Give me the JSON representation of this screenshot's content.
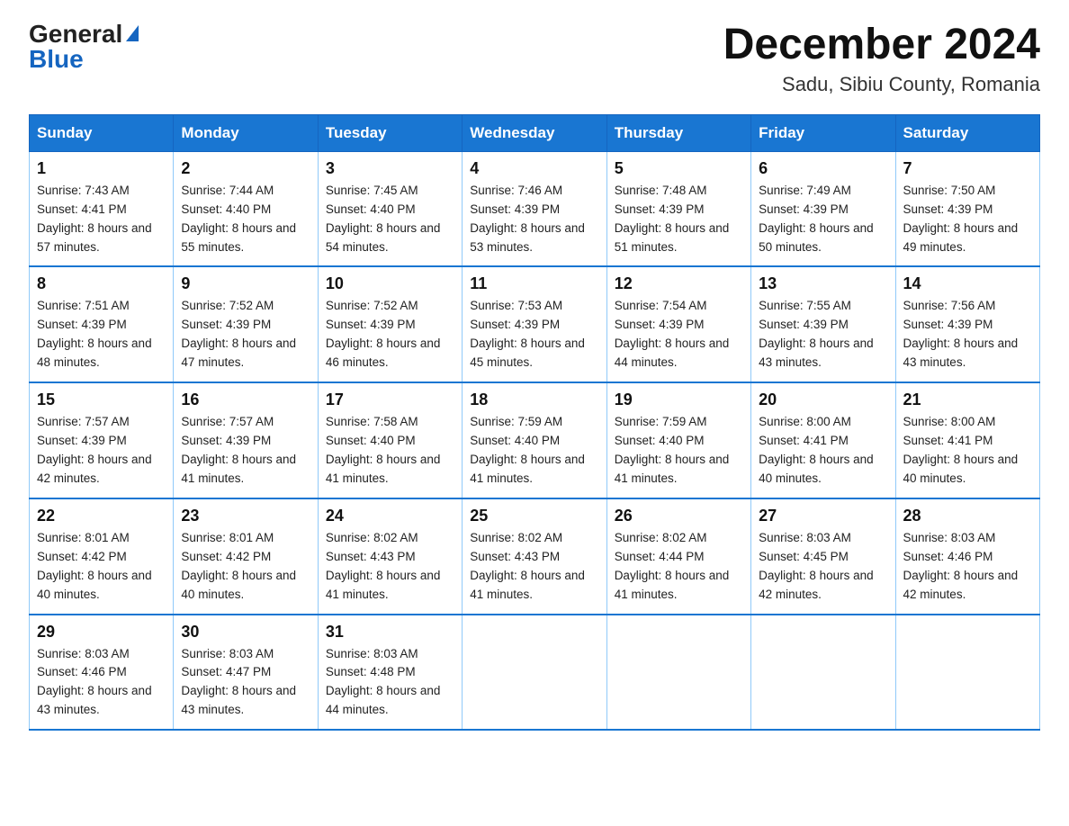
{
  "logo": {
    "general": "General",
    "blue": "Blue"
  },
  "title": "December 2024",
  "location": "Sadu, Sibiu County, Romania",
  "headers": [
    "Sunday",
    "Monday",
    "Tuesday",
    "Wednesday",
    "Thursday",
    "Friday",
    "Saturday"
  ],
  "weeks": [
    [
      {
        "day": "1",
        "sunrise": "7:43 AM",
        "sunset": "4:41 PM",
        "daylight": "8 hours and 57 minutes."
      },
      {
        "day": "2",
        "sunrise": "7:44 AM",
        "sunset": "4:40 PM",
        "daylight": "8 hours and 55 minutes."
      },
      {
        "day": "3",
        "sunrise": "7:45 AM",
        "sunset": "4:40 PM",
        "daylight": "8 hours and 54 minutes."
      },
      {
        "day": "4",
        "sunrise": "7:46 AM",
        "sunset": "4:39 PM",
        "daylight": "8 hours and 53 minutes."
      },
      {
        "day": "5",
        "sunrise": "7:48 AM",
        "sunset": "4:39 PM",
        "daylight": "8 hours and 51 minutes."
      },
      {
        "day": "6",
        "sunrise": "7:49 AM",
        "sunset": "4:39 PM",
        "daylight": "8 hours and 50 minutes."
      },
      {
        "day": "7",
        "sunrise": "7:50 AM",
        "sunset": "4:39 PM",
        "daylight": "8 hours and 49 minutes."
      }
    ],
    [
      {
        "day": "8",
        "sunrise": "7:51 AM",
        "sunset": "4:39 PM",
        "daylight": "8 hours and 48 minutes."
      },
      {
        "day": "9",
        "sunrise": "7:52 AM",
        "sunset": "4:39 PM",
        "daylight": "8 hours and 47 minutes."
      },
      {
        "day": "10",
        "sunrise": "7:52 AM",
        "sunset": "4:39 PM",
        "daylight": "8 hours and 46 minutes."
      },
      {
        "day": "11",
        "sunrise": "7:53 AM",
        "sunset": "4:39 PM",
        "daylight": "8 hours and 45 minutes."
      },
      {
        "day": "12",
        "sunrise": "7:54 AM",
        "sunset": "4:39 PM",
        "daylight": "8 hours and 44 minutes."
      },
      {
        "day": "13",
        "sunrise": "7:55 AM",
        "sunset": "4:39 PM",
        "daylight": "8 hours and 43 minutes."
      },
      {
        "day": "14",
        "sunrise": "7:56 AM",
        "sunset": "4:39 PM",
        "daylight": "8 hours and 43 minutes."
      }
    ],
    [
      {
        "day": "15",
        "sunrise": "7:57 AM",
        "sunset": "4:39 PM",
        "daylight": "8 hours and 42 minutes."
      },
      {
        "day": "16",
        "sunrise": "7:57 AM",
        "sunset": "4:39 PM",
        "daylight": "8 hours and 41 minutes."
      },
      {
        "day": "17",
        "sunrise": "7:58 AM",
        "sunset": "4:40 PM",
        "daylight": "8 hours and 41 minutes."
      },
      {
        "day": "18",
        "sunrise": "7:59 AM",
        "sunset": "4:40 PM",
        "daylight": "8 hours and 41 minutes."
      },
      {
        "day": "19",
        "sunrise": "7:59 AM",
        "sunset": "4:40 PM",
        "daylight": "8 hours and 41 minutes."
      },
      {
        "day": "20",
        "sunrise": "8:00 AM",
        "sunset": "4:41 PM",
        "daylight": "8 hours and 40 minutes."
      },
      {
        "day": "21",
        "sunrise": "8:00 AM",
        "sunset": "4:41 PM",
        "daylight": "8 hours and 40 minutes."
      }
    ],
    [
      {
        "day": "22",
        "sunrise": "8:01 AM",
        "sunset": "4:42 PM",
        "daylight": "8 hours and 40 minutes."
      },
      {
        "day": "23",
        "sunrise": "8:01 AM",
        "sunset": "4:42 PM",
        "daylight": "8 hours and 40 minutes."
      },
      {
        "day": "24",
        "sunrise": "8:02 AM",
        "sunset": "4:43 PM",
        "daylight": "8 hours and 41 minutes."
      },
      {
        "day": "25",
        "sunrise": "8:02 AM",
        "sunset": "4:43 PM",
        "daylight": "8 hours and 41 minutes."
      },
      {
        "day": "26",
        "sunrise": "8:02 AM",
        "sunset": "4:44 PM",
        "daylight": "8 hours and 41 minutes."
      },
      {
        "day": "27",
        "sunrise": "8:03 AM",
        "sunset": "4:45 PM",
        "daylight": "8 hours and 42 minutes."
      },
      {
        "day": "28",
        "sunrise": "8:03 AM",
        "sunset": "4:46 PM",
        "daylight": "8 hours and 42 minutes."
      }
    ],
    [
      {
        "day": "29",
        "sunrise": "8:03 AM",
        "sunset": "4:46 PM",
        "daylight": "8 hours and 43 minutes."
      },
      {
        "day": "30",
        "sunrise": "8:03 AM",
        "sunset": "4:47 PM",
        "daylight": "8 hours and 43 minutes."
      },
      {
        "day": "31",
        "sunrise": "8:03 AM",
        "sunset": "4:48 PM",
        "daylight": "8 hours and 44 minutes."
      },
      null,
      null,
      null,
      null
    ]
  ]
}
